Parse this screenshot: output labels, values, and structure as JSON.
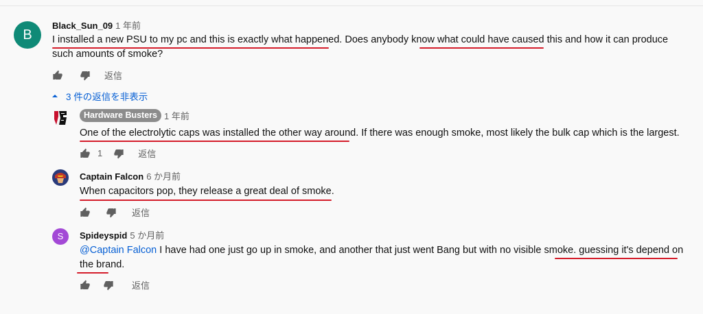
{
  "top": {
    "avatar_letter": "B",
    "author": "Black_Sun_09",
    "time": "1 年前",
    "text": "I installed a new PSU to my pc and this is exactly what happened. Does anybody know what could have caused this and how it can produce such amounts of smoke?",
    "reply_label": "返信",
    "toggle_label": "3 件の返信を非表示"
  },
  "replies": [
    {
      "author": "Hardware Busters",
      "time": "1 年前",
      "text": "One of the electrolytic caps was installed the other way around. If there was enough smoke, most likely the bulk cap which is the largest.",
      "like_count": "1",
      "reply_label": "返信"
    },
    {
      "author": "Captain Falcon",
      "time": "6 か月前",
      "text": "When capacitors pop, they release a great deal of smoke.",
      "reply_label": "返信"
    },
    {
      "author": "Spideyspid",
      "avatar_letter": "S",
      "time": "5 か月前",
      "mention": "@Captain Falcon",
      "text": " I have had one just go up in smoke, and another that just went Bang but with no visible smoke. guessing it's depend on the brand.",
      "reply_label": "返信"
    }
  ],
  "colors": {
    "underline": "#d41c2a",
    "link": "#065fd4",
    "avatar_b": "#0f8a77",
    "avatar_s": "#a349d6"
  }
}
